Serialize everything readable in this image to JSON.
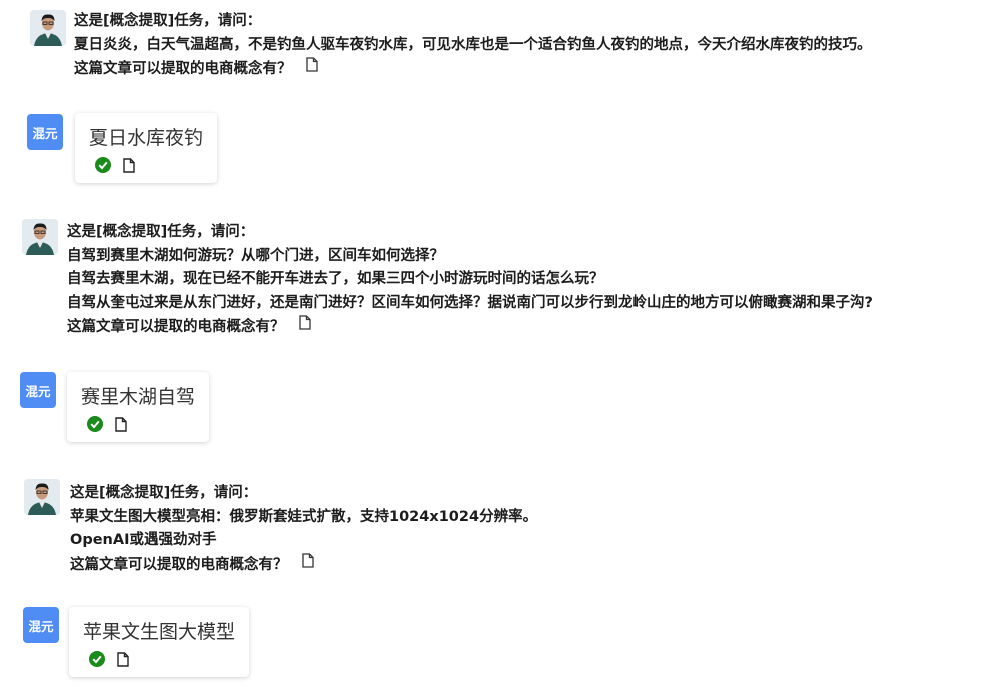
{
  "colors": {
    "badge_bg": "#4f8df5",
    "check_green": "#1a8a1a",
    "text": "#1c1c1c"
  },
  "conversations": [
    {
      "question": {
        "lines": [
          "这是[概念提取]任务，请问：",
          "夏日炎炎，白天气温超高，不是钓鱼人驱车夜钓水库，可见水库也是一个适合钓鱼人夜钓的地点，今天介绍水库夜钓的技巧。",
          "这篇文章可以提取的电商概念有？"
        ]
      },
      "answer": {
        "badge": "混元",
        "text": "夏日水库夜钓"
      }
    },
    {
      "question": {
        "lines": [
          "这是[概念提取]任务，请问：",
          "自驾到赛里木湖如何游玩？从哪个门进，区间车如何选择？",
          "自驾去赛里木湖，现在已经不能开车进去了，如果三四个小时游玩时间的话怎么玩？",
          "自驾从奎屯过来是从东门进好，还是南门进好？区间车如何选择？据说南门可以步行到龙岭山庄的地方可以俯瞰赛湖和果子沟?",
          "这篇文章可以提取的电商概念有？"
        ]
      },
      "answer": {
        "badge": "混元",
        "text": "赛里木湖自驾"
      }
    },
    {
      "question": {
        "lines": [
          "这是[概念提取]任务，请问：",
          "苹果文生图大模型亮相：俄罗斯套娃式扩散，支持1024x1024分辨率。",
          "OpenAI或遇强劲对手",
          "这篇文章可以提取的电商概念有？"
        ]
      },
      "answer": {
        "badge": "混元",
        "text": "苹果文生图大模型"
      }
    }
  ]
}
